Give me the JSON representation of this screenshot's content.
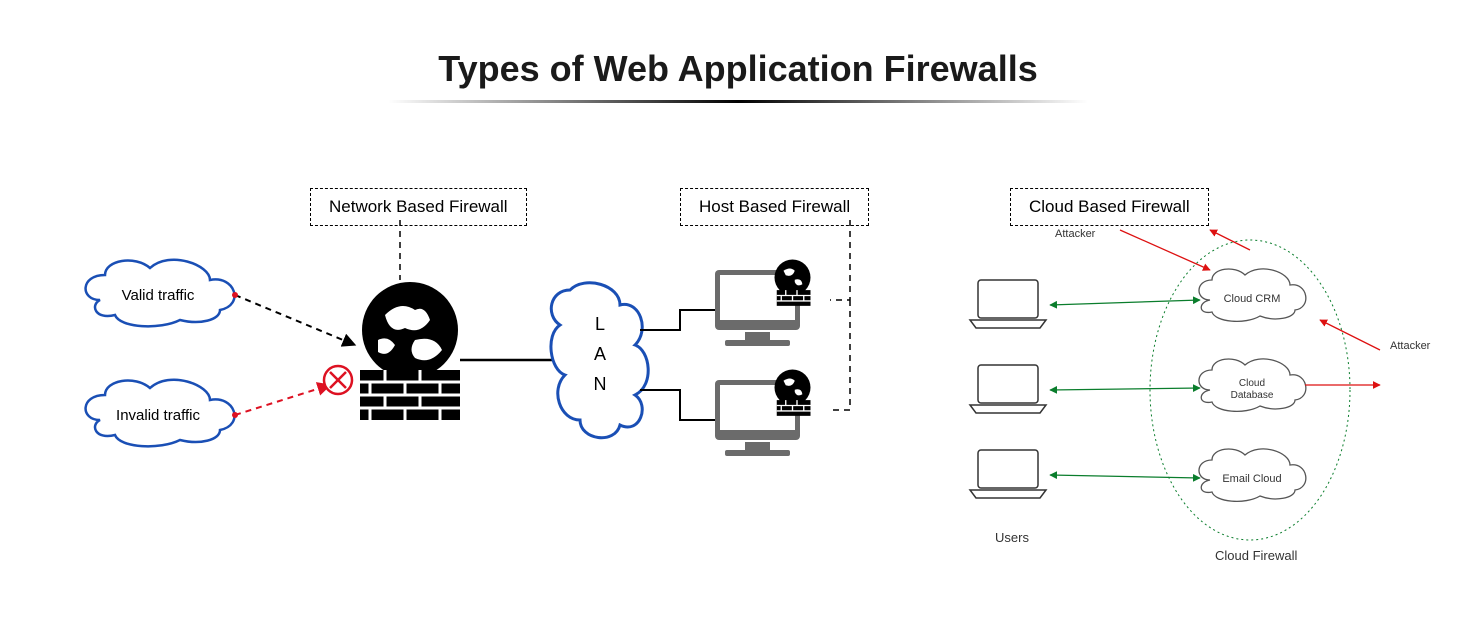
{
  "title": "Types of Web Application Firewalls",
  "sections": {
    "network": "Network Based Firewall",
    "host": "Host Based Firewall",
    "cloud": "Cloud Based Firewall"
  },
  "traffic": {
    "valid": "Valid traffic",
    "invalid": "Invalid traffic"
  },
  "lan": "L A N",
  "cloud": {
    "attacker_top": "Attacker",
    "attacker_right": "Attacker",
    "users": "Users",
    "firewall_label": "Cloud Firewall",
    "services": {
      "crm": "Cloud CRM",
      "db": "Cloud Database",
      "email": "Email Cloud"
    }
  }
}
